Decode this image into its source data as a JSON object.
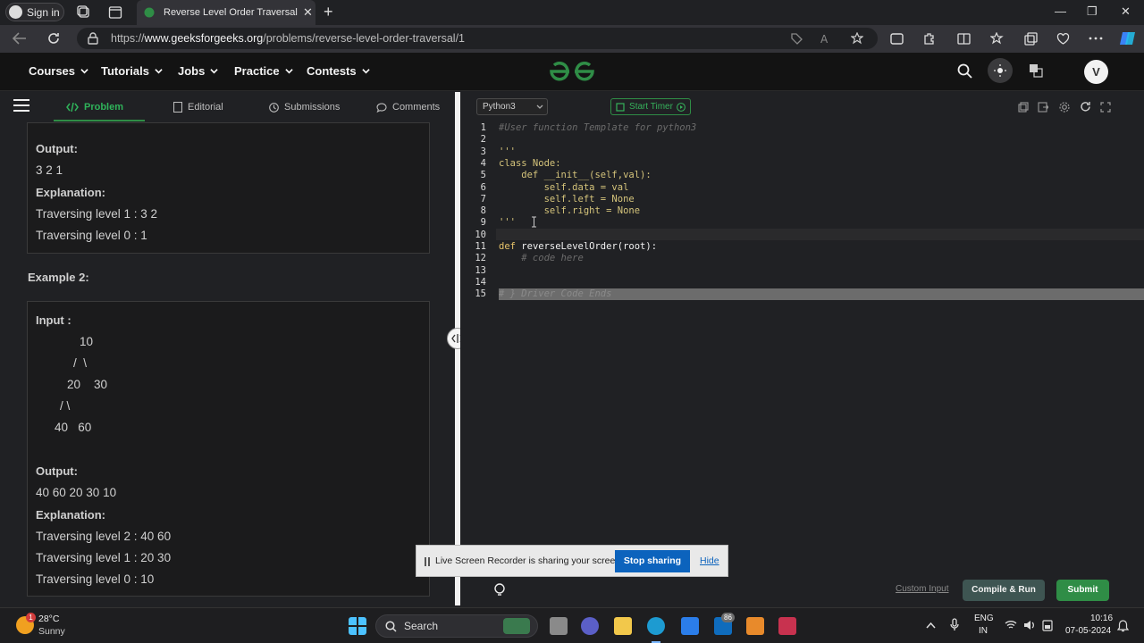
{
  "browser": {
    "signin_label": "Sign in",
    "tab_title": "Reverse Level Order Traversal | P",
    "tab_close": "✕",
    "new_tab": "+",
    "url_prefix": "https://",
    "url_domain": "www.geeksforgeeks.org",
    "url_path": "/problems/reverse-level-order-traversal/1",
    "window_controls": [
      "—",
      "❐",
      "✕"
    ]
  },
  "header": {
    "nav": [
      "Courses",
      "Tutorials",
      "Jobs",
      "Practice",
      "Contests"
    ],
    "avatar_letter": "V",
    "brand_color": "#2f8d46"
  },
  "left_tabs": [
    "Problem",
    "Editorial",
    "Submissions",
    "Comments"
  ],
  "problem": {
    "example1": {
      "output_label": "Output:",
      "output_value": "3 2 1",
      "explanation_label": "Explanation:",
      "lines": [
        "Traversing level 1 : 3 2",
        "Traversing level 0 : 1"
      ]
    },
    "example2": {
      "title": "Example 2:",
      "input_label": "Input :",
      "tree": [
        "10",
        "/  \\",
        "20    30",
        "/ \\",
        "40   60"
      ],
      "output_label": "Output:",
      "output_value": "40 60 20 30 10",
      "explanation_label": "Explanation:",
      "lines": [
        "Traversing level 2 : 40 60",
        "Traversing level 1 : 20 30",
        "Traversing level 0 : 10"
      ]
    }
  },
  "editor": {
    "language": "Python3",
    "timer_label": "Start Timer",
    "line_numbers": [
      "1",
      "2",
      "3",
      "4",
      "5",
      "6",
      "7",
      "8",
      "9",
      "10",
      "11",
      "12",
      "13",
      "14",
      "15"
    ],
    "code": {
      "l1": "#User function Template for python3",
      "l2": "'''",
      "l4": "class Node:",
      "l5": "    def __init__(self,val):",
      "l6": "        self.data = val",
      "l7": "        self.left = None",
      "l8": "        self.right = None",
      "l9": "'''",
      "l11a": "def ",
      "l11b": "reverseLevelOrder",
      "l11c": "(root):",
      "l12": "    # code here",
      "l15": "# } Driver Code Ends"
    },
    "custom_input": "Custom Input",
    "compile_run": "Compile & Run",
    "submit": "Submit"
  },
  "share_banner": {
    "text": "Live Screen Recorder is sharing your screen.",
    "stop": "Stop sharing",
    "hide": "Hide"
  },
  "taskbar": {
    "weather_temp": "28°C",
    "weather_desc": "Sunny",
    "weather_badge": "1",
    "search_label": "Search",
    "mail_badge": "86",
    "lang1": "ENG",
    "lang2": "IN",
    "time": "10:16",
    "date": "07-05-2024"
  }
}
